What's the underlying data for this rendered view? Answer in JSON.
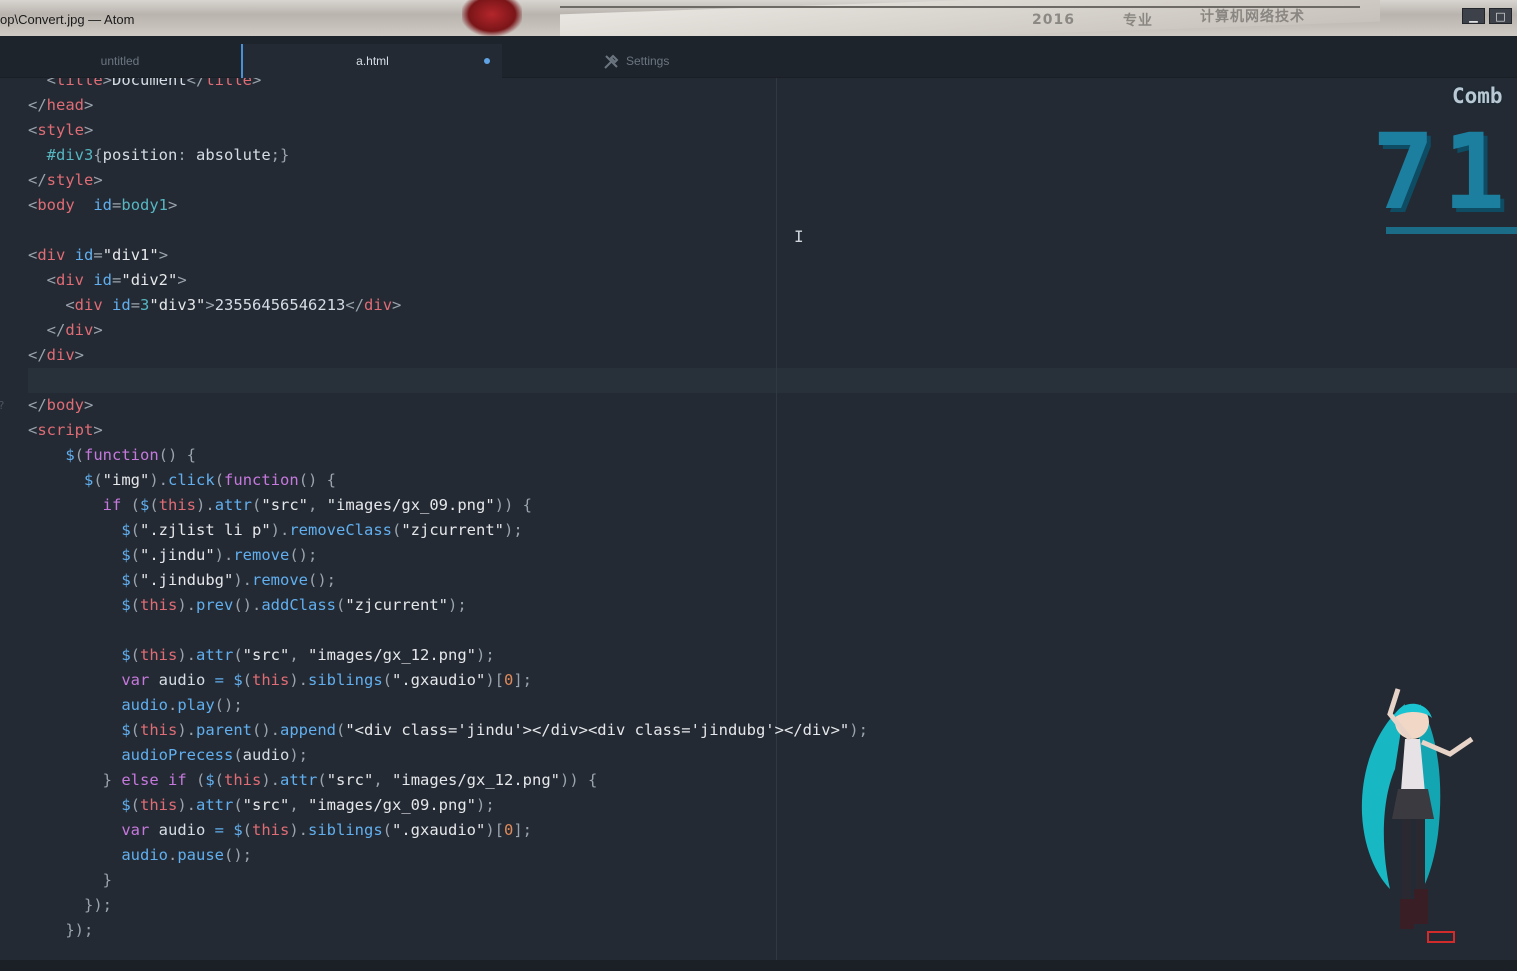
{
  "window": {
    "title": "op\\Convert.jpg — Atom",
    "minimize_icon": "minimize-icon",
    "maximize_icon": "maximize-icon",
    "minimize_glyph": "▁",
    "maximize_glyph": "□",
    "background_text": [
      "2016",
      "专业",
      "计算机网络技术"
    ]
  },
  "tabs": [
    {
      "label": "untitled",
      "active": false
    },
    {
      "label": "a.html",
      "active": true,
      "modified": true
    },
    {
      "label": "Settings",
      "active": false,
      "icon": "settings-icon"
    }
  ],
  "editor": {
    "accent_color": "#4a90d9",
    "background_color": "#232a33",
    "gutter_marks": [
      "",
      "",
      "",
      "",
      "",
      "",
      "",
      "",
      "",
      "",
      "",
      "",
      "",
      "?",
      "",
      "",
      "",
      "",
      "",
      "",
      "",
      "",
      "",
      "",
      "",
      "",
      "",
      "",
      "",
      "",
      "",
      "",
      "",
      "",
      "",
      ""
    ],
    "lines": [
      [
        [
          "t-br",
          "  <"
        ],
        [
          "t-tag",
          "title"
        ],
        [
          "t-br",
          ">"
        ],
        [
          "t-var",
          "Document"
        ],
        [
          "t-br",
          "</"
        ],
        [
          "t-tag",
          "title"
        ],
        [
          "t-br",
          ">"
        ]
      ],
      [
        [
          "t-br",
          "</"
        ],
        [
          "t-tag",
          "head"
        ],
        [
          "t-br",
          ">"
        ]
      ],
      [
        [
          "t-br",
          "<"
        ],
        [
          "t-tag",
          "style"
        ],
        [
          "t-br",
          ">"
        ]
      ],
      [
        [
          "t-sel",
          "  #div3"
        ],
        [
          "t-br",
          "{"
        ],
        [
          "t-var",
          "position"
        ],
        [
          "t-br",
          ": "
        ],
        [
          "t-var",
          "absolute"
        ],
        [
          "t-br",
          ";}"
        ]
      ],
      [
        [
          "t-br",
          "</"
        ],
        [
          "t-tag",
          "style"
        ],
        [
          "t-br",
          ">"
        ]
      ],
      [
        [
          "t-br",
          "<"
        ],
        [
          "t-tag",
          "body"
        ],
        [
          "t-var",
          "  "
        ],
        [
          "t-att",
          "id"
        ],
        [
          "t-br",
          "="
        ],
        [
          "t-sel",
          "body1"
        ],
        [
          "t-br",
          ">"
        ]
      ],
      [],
      [
        [
          "t-br",
          "<"
        ],
        [
          "t-tag",
          "div"
        ],
        [
          "t-var",
          " "
        ],
        [
          "t-att",
          "id"
        ],
        [
          "t-br",
          "="
        ],
        [
          "t-str",
          "\"div1\""
        ],
        [
          "t-br",
          ">"
        ]
      ],
      [
        [
          "t-br",
          "  <"
        ],
        [
          "t-tag",
          "div"
        ],
        [
          "t-var",
          " "
        ],
        [
          "t-att",
          "id"
        ],
        [
          "t-br",
          "="
        ],
        [
          "t-str",
          "\"div2\""
        ],
        [
          "t-br",
          ">"
        ]
      ],
      [
        [
          "t-br",
          "    <"
        ],
        [
          "t-tag",
          "div"
        ],
        [
          "t-var",
          " "
        ],
        [
          "t-att",
          "id"
        ],
        [
          "t-br",
          "="
        ],
        [
          "t-sel",
          "3"
        ],
        [
          "t-str",
          "\"div3\""
        ],
        [
          "t-br",
          ">"
        ],
        [
          "t-var",
          "23556456546213"
        ],
        [
          "t-br",
          "</"
        ],
        [
          "t-tag",
          "div"
        ],
        [
          "t-br",
          ">"
        ]
      ],
      [
        [
          "t-br",
          "  </"
        ],
        [
          "t-tag",
          "div"
        ],
        [
          "t-br",
          ">"
        ]
      ],
      [
        [
          "t-br",
          "</"
        ],
        [
          "t-tag",
          "div"
        ],
        [
          "t-br",
          ">"
        ]
      ],
      [],
      [
        [
          "t-br",
          "</"
        ],
        [
          "t-tag",
          "body"
        ],
        [
          "t-br",
          ">"
        ]
      ],
      [
        [
          "t-br",
          "<"
        ],
        [
          "t-tag",
          "script"
        ],
        [
          "t-br",
          ">"
        ]
      ],
      [
        [
          "t-fn",
          "    $"
        ],
        [
          "t-br",
          "("
        ],
        [
          "t-kw",
          "function"
        ],
        [
          "t-br",
          "() {"
        ]
      ],
      [
        [
          "t-fn",
          "      $"
        ],
        [
          "t-br",
          "("
        ],
        [
          "t-str",
          "\"img\""
        ],
        [
          "t-br",
          ")."
        ],
        [
          "t-fn",
          "click"
        ],
        [
          "t-br",
          "("
        ],
        [
          "t-kw",
          "function"
        ],
        [
          "t-br",
          "() {"
        ]
      ],
      [
        [
          "t-kw",
          "        if "
        ],
        [
          "t-br",
          "("
        ],
        [
          "t-fn",
          "$"
        ],
        [
          "t-br",
          "("
        ],
        [
          "t-th",
          "this"
        ],
        [
          "t-br",
          ")."
        ],
        [
          "t-fn",
          "attr"
        ],
        [
          "t-br",
          "("
        ],
        [
          "t-str",
          "\"src\""
        ],
        [
          "t-br",
          ", "
        ],
        [
          "t-str",
          "\"images/gx_09.png\""
        ],
        [
          "t-br",
          ")) {"
        ]
      ],
      [
        [
          "t-fn",
          "          $"
        ],
        [
          "t-br",
          "("
        ],
        [
          "t-str",
          "\".zjlist li p\""
        ],
        [
          "t-br",
          ")."
        ],
        [
          "t-fn",
          "removeClass"
        ],
        [
          "t-br",
          "("
        ],
        [
          "t-str",
          "\"zjcurrent\""
        ],
        [
          "t-br",
          ");"
        ]
      ],
      [
        [
          "t-fn",
          "          $"
        ],
        [
          "t-br",
          "("
        ],
        [
          "t-str",
          "\".jindu\""
        ],
        [
          "t-br",
          ")."
        ],
        [
          "t-fn",
          "remove"
        ],
        [
          "t-br",
          "();"
        ]
      ],
      [
        [
          "t-fn",
          "          $"
        ],
        [
          "t-br",
          "("
        ],
        [
          "t-str",
          "\".jindubg\""
        ],
        [
          "t-br",
          ")."
        ],
        [
          "t-fn",
          "remove"
        ],
        [
          "t-br",
          "();"
        ]
      ],
      [
        [
          "t-fn",
          "          $"
        ],
        [
          "t-br",
          "("
        ],
        [
          "t-th",
          "this"
        ],
        [
          "t-br",
          ")."
        ],
        [
          "t-fn",
          "prev"
        ],
        [
          "t-br",
          "()."
        ],
        [
          "t-fn",
          "addClass"
        ],
        [
          "t-br",
          "("
        ],
        [
          "t-str",
          "\"zjcurrent\""
        ],
        [
          "t-br",
          ");"
        ]
      ],
      [],
      [
        [
          "t-fn",
          "          $"
        ],
        [
          "t-br",
          "("
        ],
        [
          "t-th",
          "this"
        ],
        [
          "t-br",
          ")."
        ],
        [
          "t-fn",
          "attr"
        ],
        [
          "t-br",
          "("
        ],
        [
          "t-str",
          "\"src\""
        ],
        [
          "t-br",
          ", "
        ],
        [
          "t-str",
          "\"images/gx_12.png\""
        ],
        [
          "t-br",
          ");"
        ]
      ],
      [
        [
          "t-kw",
          "          var "
        ],
        [
          "t-var",
          "audio "
        ],
        [
          "t-fn",
          "= $"
        ],
        [
          "t-br",
          "("
        ],
        [
          "t-th",
          "this"
        ],
        [
          "t-br",
          ")."
        ],
        [
          "t-fn",
          "siblings"
        ],
        [
          "t-br",
          "("
        ],
        [
          "t-str",
          "\".gxaudio\""
        ],
        [
          "t-br",
          ")["
        ],
        [
          "t-num",
          "0"
        ],
        [
          "t-br",
          "];"
        ]
      ],
      [
        [
          "t-fn",
          "          audio"
        ],
        [
          "t-br",
          "."
        ],
        [
          "t-fn",
          "play"
        ],
        [
          "t-br",
          "();"
        ]
      ],
      [
        [
          "t-fn",
          "          $"
        ],
        [
          "t-br",
          "("
        ],
        [
          "t-th",
          "this"
        ],
        [
          "t-br",
          ")."
        ],
        [
          "t-fn",
          "parent"
        ],
        [
          "t-br",
          "()."
        ],
        [
          "t-fn",
          "append"
        ],
        [
          "t-br",
          "("
        ],
        [
          "t-str",
          "\"<div class='jindu'></div><div class='jindubg'></div>\""
        ],
        [
          "t-br",
          ");"
        ]
      ],
      [
        [
          "t-fn",
          "          audioPrecess"
        ],
        [
          "t-br",
          "("
        ],
        [
          "t-var",
          "audio"
        ],
        [
          "t-br",
          ");"
        ]
      ],
      [
        [
          "t-br",
          "        } "
        ],
        [
          "t-kw",
          "else if "
        ],
        [
          "t-br",
          "("
        ],
        [
          "t-fn",
          "$"
        ],
        [
          "t-br",
          "("
        ],
        [
          "t-th",
          "this"
        ],
        [
          "t-br",
          ")."
        ],
        [
          "t-fn",
          "attr"
        ],
        [
          "t-br",
          "("
        ],
        [
          "t-str",
          "\"src\""
        ],
        [
          "t-br",
          ", "
        ],
        [
          "t-str",
          "\"images/gx_12.png\""
        ],
        [
          "t-br",
          ")) {"
        ]
      ],
      [
        [
          "t-fn",
          "          $"
        ],
        [
          "t-br",
          "("
        ],
        [
          "t-th",
          "this"
        ],
        [
          "t-br",
          ")."
        ],
        [
          "t-fn",
          "attr"
        ],
        [
          "t-br",
          "("
        ],
        [
          "t-str",
          "\"src\""
        ],
        [
          "t-br",
          ", "
        ],
        [
          "t-str",
          "\"images/gx_09.png\""
        ],
        [
          "t-br",
          ");"
        ]
      ],
      [
        [
          "t-kw",
          "          var "
        ],
        [
          "t-var",
          "audio "
        ],
        [
          "t-fn",
          "= $"
        ],
        [
          "t-br",
          "("
        ],
        [
          "t-th",
          "this"
        ],
        [
          "t-br",
          ")."
        ],
        [
          "t-fn",
          "siblings"
        ],
        [
          "t-br",
          "("
        ],
        [
          "t-str",
          "\".gxaudio\""
        ],
        [
          "t-br",
          ")["
        ],
        [
          "t-num",
          "0"
        ],
        [
          "t-br",
          "];"
        ]
      ],
      [
        [
          "t-fn",
          "          audio"
        ],
        [
          "t-br",
          "."
        ],
        [
          "t-fn",
          "pause"
        ],
        [
          "t-br",
          "();"
        ]
      ],
      [
        [
          "t-br",
          "        }"
        ]
      ],
      [
        [
          "t-br",
          "      });"
        ]
      ],
      [
        [
          "t-br",
          "    });"
        ]
      ]
    ]
  },
  "overlay": {
    "combo_label": "Comb",
    "combo_value": "71",
    "combo_color": "#1c7fa0",
    "mascot": "anime-mascot-figure"
  }
}
